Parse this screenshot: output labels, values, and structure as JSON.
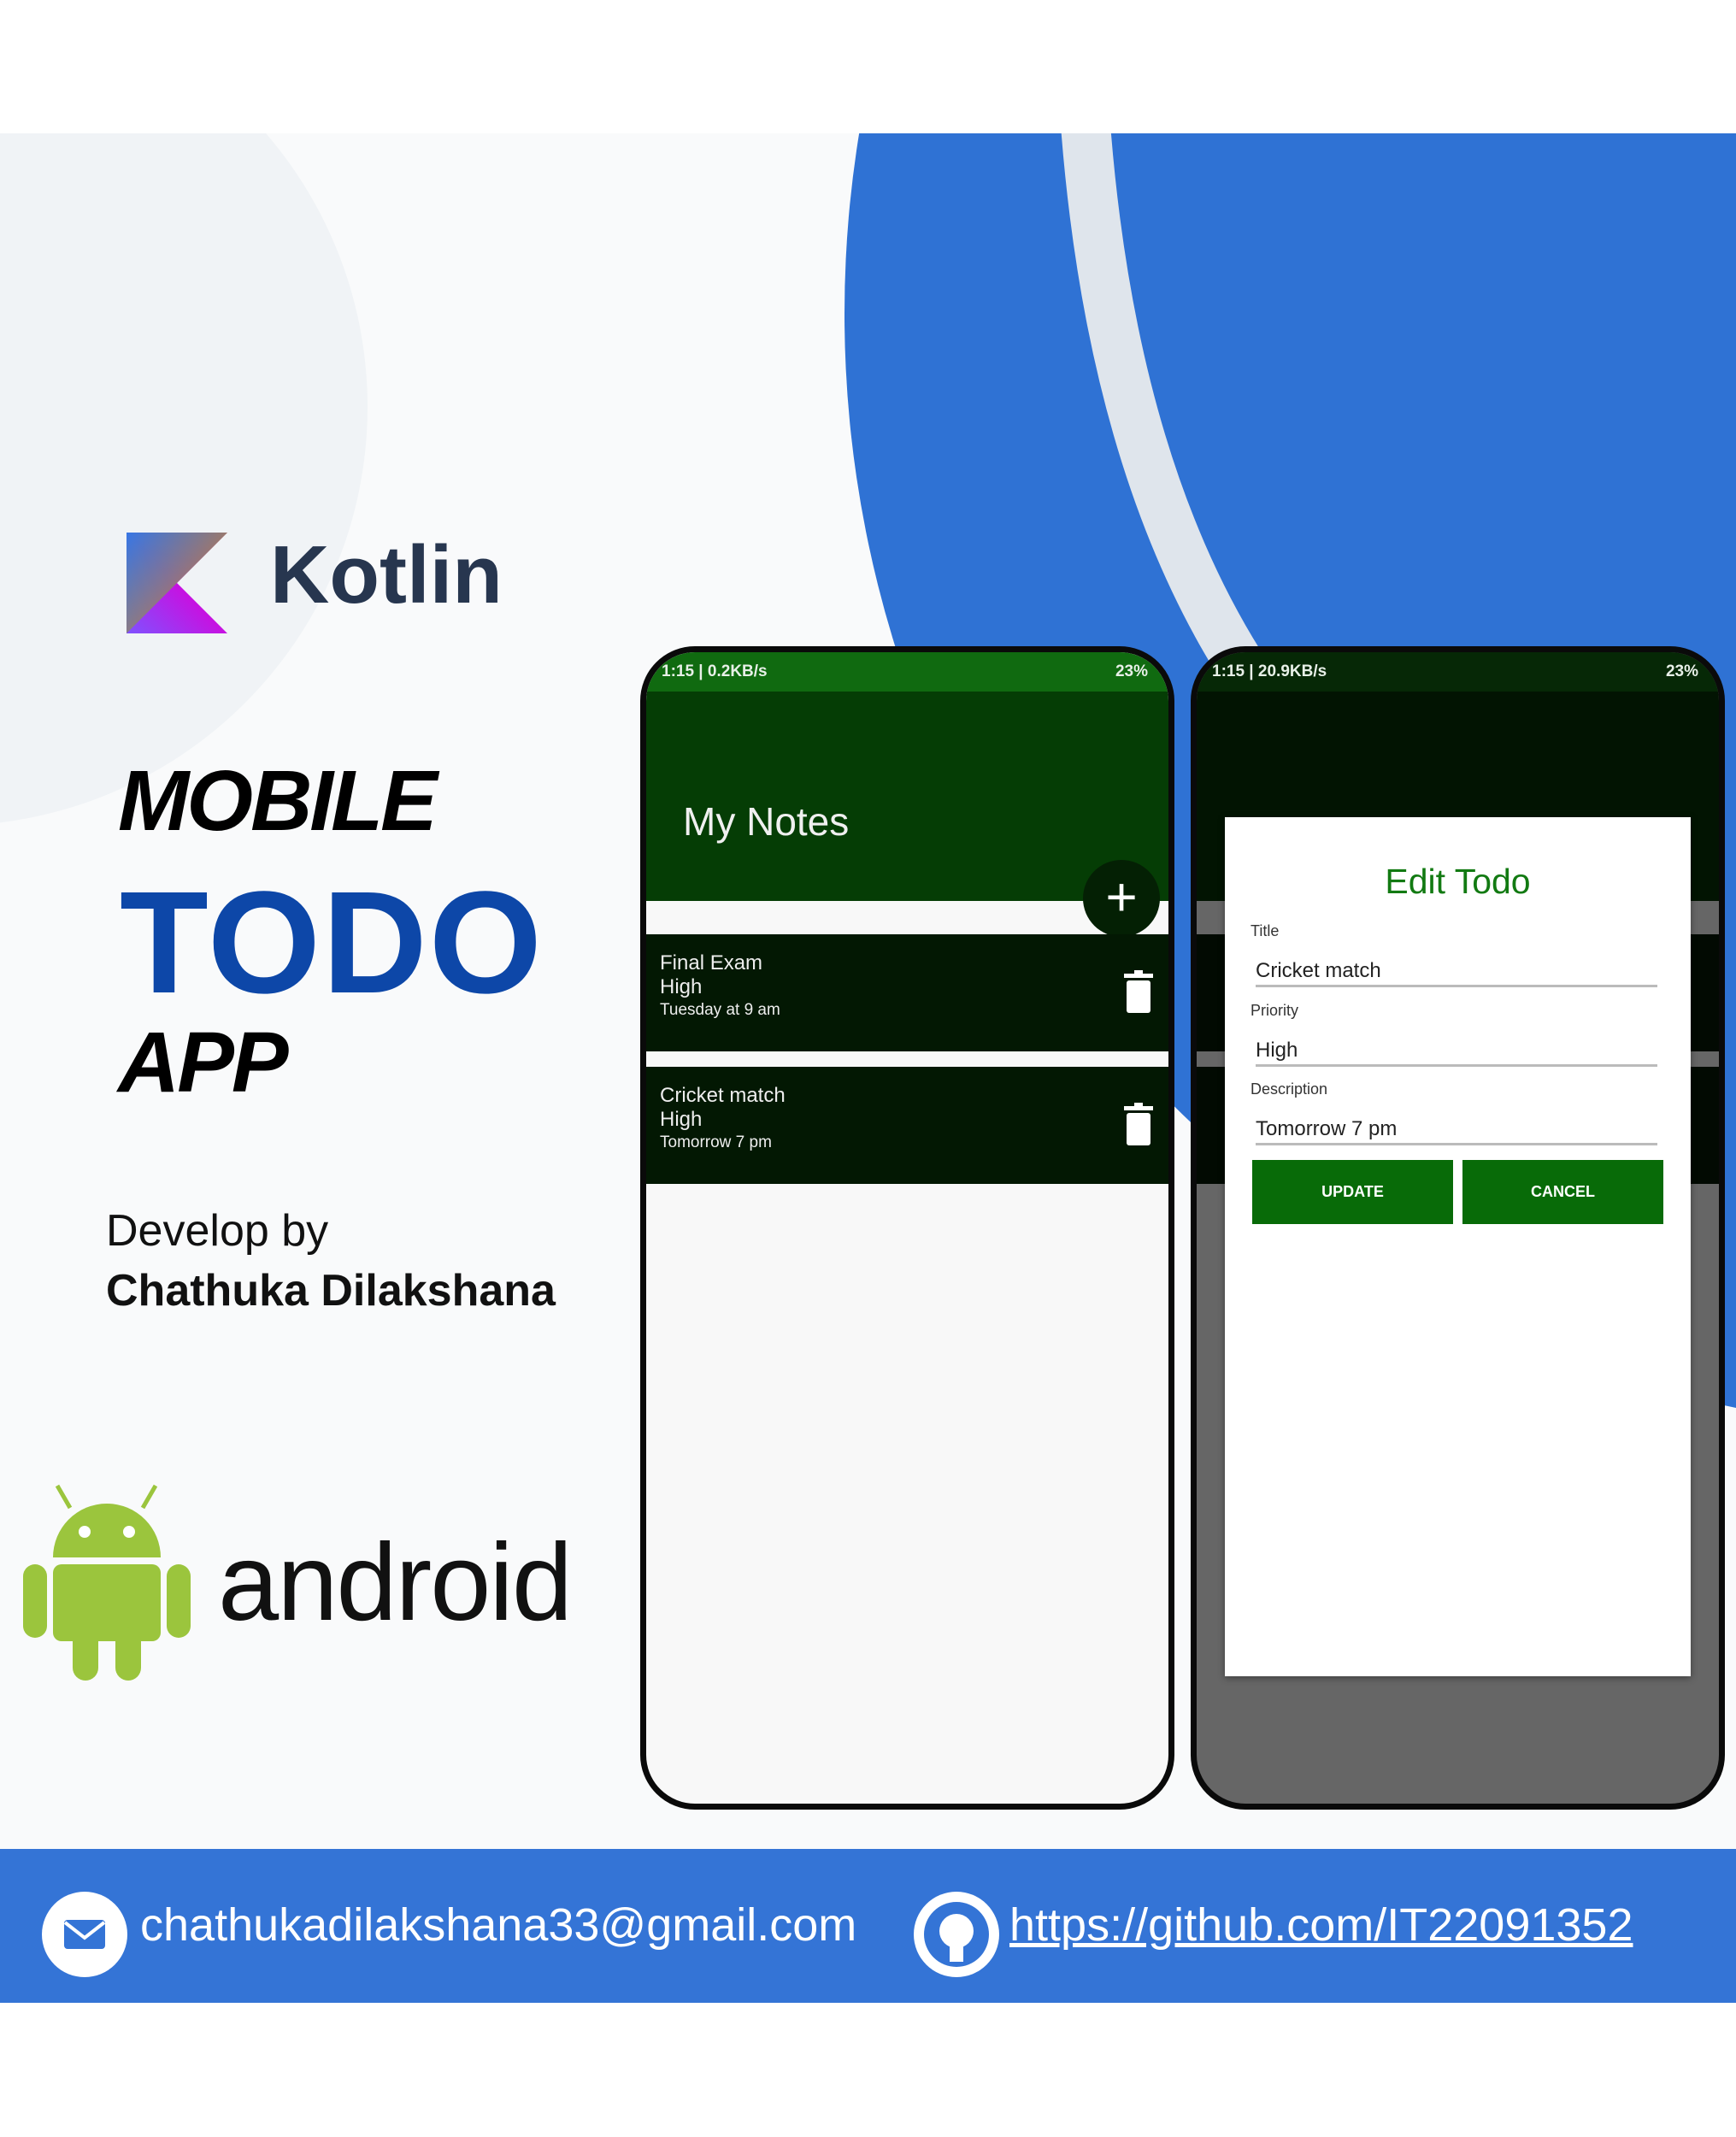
{
  "branding": {
    "kotlin": "Kotlin",
    "line1": "MOBILE",
    "line2": "TODO",
    "line3": "APP",
    "develop_by": "Develop by",
    "developer": "Chathuka Dilakshana",
    "android": "android"
  },
  "colors": {
    "accent_blue": "#0d47a8",
    "footer_blue": "#3474d6",
    "app_green": "#086b08",
    "dark_green": "#053d05"
  },
  "phone1": {
    "status": {
      "left": "1:15 | 0.2KB/s",
      "right": "23%"
    },
    "app_title": "My Notes",
    "fab_icon": "plus-icon",
    "notes": [
      {
        "title": "Final Exam",
        "priority": "High",
        "description": "Tuesday at 9 am"
      },
      {
        "title": "Cricket match",
        "priority": "High",
        "description": "Tomorrow 7 pm"
      }
    ]
  },
  "phone2": {
    "status": {
      "left": "1:15 | 20.9KB/s",
      "right": "23%"
    },
    "dialog": {
      "title": "Edit Todo",
      "title_label": "Title",
      "title_value": "Cricket match",
      "priority_label": "Priority",
      "priority_value": "High",
      "description_label": "Description",
      "description_value": "Tomorrow 7 pm",
      "update": "UPDATE",
      "cancel": "CANCEL"
    }
  },
  "footer": {
    "email": "chathukadilakshana33@gmail.com",
    "github": "https://github.com/IT22091352"
  }
}
